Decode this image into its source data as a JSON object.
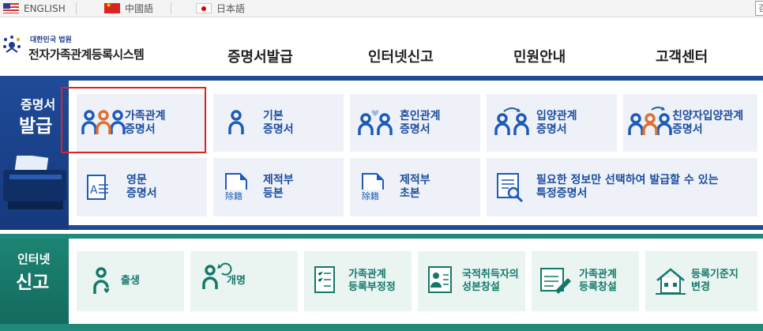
{
  "lang": {
    "english": "ENGLISH",
    "chinese": "中國語",
    "japanese": "日本語",
    "search_partial": "검"
  },
  "logo": {
    "small": "대한민국 법원",
    "big": "전자가족관계등록시스템"
  },
  "nav": [
    "증명서발급",
    "인터넷신고",
    "민원안내",
    "고객센터"
  ],
  "issue": {
    "title_small": "증명서",
    "title_big": "발급",
    "cards": [
      {
        "l1": "가족관계",
        "l2": "증명서",
        "icon": "family-icon"
      },
      {
        "l1": "기본",
        "l2": "증명서",
        "icon": "person-icon"
      },
      {
        "l1": "혼인관계",
        "l2": "증명서",
        "icon": "marriage-icon"
      },
      {
        "l1": "입양관계",
        "l2": "증명서",
        "icon": "adoption-icon"
      },
      {
        "l1": "친양자입양관계",
        "l2": "증명서",
        "icon": "full-adoption-icon"
      },
      {
        "l1": "영문",
        "l2": "증명서",
        "icon": "english-doc-icon"
      },
      {
        "l1": "제적부",
        "l2": "등본",
        "icon": "removed-register-copy-icon"
      },
      {
        "l1": "제적부",
        "l2": "초본",
        "icon": "removed-register-extract-icon"
      },
      {
        "l1": "필요한 정보만 선택하여 발급할 수 있는",
        "l2": "특정증명서",
        "icon": "specific-certificate-icon"
      }
    ],
    "stamp": "除籍"
  },
  "report": {
    "title_small": "인터넷",
    "title_big": "신고",
    "cards": [
      {
        "l1": "출생",
        "l2": "",
        "icon": "birth-icon"
      },
      {
        "l1": "개명",
        "l2": "",
        "icon": "name-change-icon"
      },
      {
        "l1": "가족관계",
        "l2": "등록부정정",
        "icon": "register-correction-icon"
      },
      {
        "l1": "국적취득자의",
        "l2": "성본창설",
        "icon": "naturalization-icon"
      },
      {
        "l1": "가족관계",
        "l2": "등록창설",
        "icon": "register-creation-icon"
      },
      {
        "l1": "등록기준지",
        "l2": "변경",
        "icon": "home-change-icon"
      }
    ]
  },
  "colors": {
    "blue": "#1e4a97",
    "green": "#1f8a7a",
    "highlight": "#e12020"
  }
}
